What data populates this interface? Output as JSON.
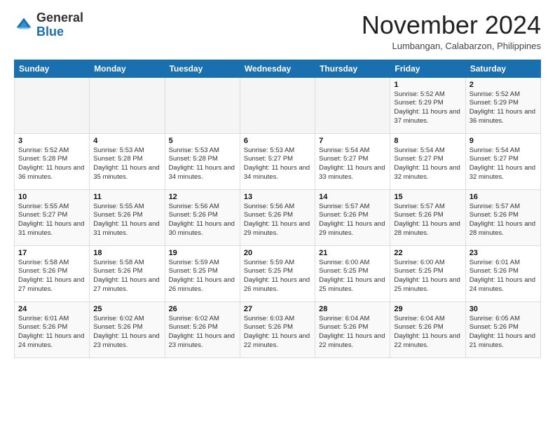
{
  "header": {
    "logo": {
      "general": "General",
      "blue": "Blue"
    },
    "title": "November 2024",
    "subtitle": "Lumbangan, Calabarzon, Philippines"
  },
  "weekdays": [
    "Sunday",
    "Monday",
    "Tuesday",
    "Wednesday",
    "Thursday",
    "Friday",
    "Saturday"
  ],
  "weeks": [
    [
      {
        "day": "",
        "info": ""
      },
      {
        "day": "",
        "info": ""
      },
      {
        "day": "",
        "info": ""
      },
      {
        "day": "",
        "info": ""
      },
      {
        "day": "",
        "info": ""
      },
      {
        "day": "1",
        "info": "Sunrise: 5:52 AM\nSunset: 5:29 PM\nDaylight: 11 hours and 37 minutes."
      },
      {
        "day": "2",
        "info": "Sunrise: 5:52 AM\nSunset: 5:29 PM\nDaylight: 11 hours and 36 minutes."
      }
    ],
    [
      {
        "day": "3",
        "info": "Sunrise: 5:52 AM\nSunset: 5:28 PM\nDaylight: 11 hours and 36 minutes."
      },
      {
        "day": "4",
        "info": "Sunrise: 5:53 AM\nSunset: 5:28 PM\nDaylight: 11 hours and 35 minutes."
      },
      {
        "day": "5",
        "info": "Sunrise: 5:53 AM\nSunset: 5:28 PM\nDaylight: 11 hours and 34 minutes."
      },
      {
        "day": "6",
        "info": "Sunrise: 5:53 AM\nSunset: 5:27 PM\nDaylight: 11 hours and 34 minutes."
      },
      {
        "day": "7",
        "info": "Sunrise: 5:54 AM\nSunset: 5:27 PM\nDaylight: 11 hours and 33 minutes."
      },
      {
        "day": "8",
        "info": "Sunrise: 5:54 AM\nSunset: 5:27 PM\nDaylight: 11 hours and 32 minutes."
      },
      {
        "day": "9",
        "info": "Sunrise: 5:54 AM\nSunset: 5:27 PM\nDaylight: 11 hours and 32 minutes."
      }
    ],
    [
      {
        "day": "10",
        "info": "Sunrise: 5:55 AM\nSunset: 5:27 PM\nDaylight: 11 hours and 31 minutes."
      },
      {
        "day": "11",
        "info": "Sunrise: 5:55 AM\nSunset: 5:26 PM\nDaylight: 11 hours and 31 minutes."
      },
      {
        "day": "12",
        "info": "Sunrise: 5:56 AM\nSunset: 5:26 PM\nDaylight: 11 hours and 30 minutes."
      },
      {
        "day": "13",
        "info": "Sunrise: 5:56 AM\nSunset: 5:26 PM\nDaylight: 11 hours and 29 minutes."
      },
      {
        "day": "14",
        "info": "Sunrise: 5:57 AM\nSunset: 5:26 PM\nDaylight: 11 hours and 29 minutes."
      },
      {
        "day": "15",
        "info": "Sunrise: 5:57 AM\nSunset: 5:26 PM\nDaylight: 11 hours and 28 minutes."
      },
      {
        "day": "16",
        "info": "Sunrise: 5:57 AM\nSunset: 5:26 PM\nDaylight: 11 hours and 28 minutes."
      }
    ],
    [
      {
        "day": "17",
        "info": "Sunrise: 5:58 AM\nSunset: 5:26 PM\nDaylight: 11 hours and 27 minutes."
      },
      {
        "day": "18",
        "info": "Sunrise: 5:58 AM\nSunset: 5:26 PM\nDaylight: 11 hours and 27 minutes."
      },
      {
        "day": "19",
        "info": "Sunrise: 5:59 AM\nSunset: 5:25 PM\nDaylight: 11 hours and 26 minutes."
      },
      {
        "day": "20",
        "info": "Sunrise: 5:59 AM\nSunset: 5:25 PM\nDaylight: 11 hours and 26 minutes."
      },
      {
        "day": "21",
        "info": "Sunrise: 6:00 AM\nSunset: 5:25 PM\nDaylight: 11 hours and 25 minutes."
      },
      {
        "day": "22",
        "info": "Sunrise: 6:00 AM\nSunset: 5:25 PM\nDaylight: 11 hours and 25 minutes."
      },
      {
        "day": "23",
        "info": "Sunrise: 6:01 AM\nSunset: 5:26 PM\nDaylight: 11 hours and 24 minutes."
      }
    ],
    [
      {
        "day": "24",
        "info": "Sunrise: 6:01 AM\nSunset: 5:26 PM\nDaylight: 11 hours and 24 minutes."
      },
      {
        "day": "25",
        "info": "Sunrise: 6:02 AM\nSunset: 5:26 PM\nDaylight: 11 hours and 23 minutes."
      },
      {
        "day": "26",
        "info": "Sunrise: 6:02 AM\nSunset: 5:26 PM\nDaylight: 11 hours and 23 minutes."
      },
      {
        "day": "27",
        "info": "Sunrise: 6:03 AM\nSunset: 5:26 PM\nDaylight: 11 hours and 22 minutes."
      },
      {
        "day": "28",
        "info": "Sunrise: 6:04 AM\nSunset: 5:26 PM\nDaylight: 11 hours and 22 minutes."
      },
      {
        "day": "29",
        "info": "Sunrise: 6:04 AM\nSunset: 5:26 PM\nDaylight: 11 hours and 22 minutes."
      },
      {
        "day": "30",
        "info": "Sunrise: 6:05 AM\nSunset: 5:26 PM\nDaylight: 11 hours and 21 minutes."
      }
    ]
  ]
}
